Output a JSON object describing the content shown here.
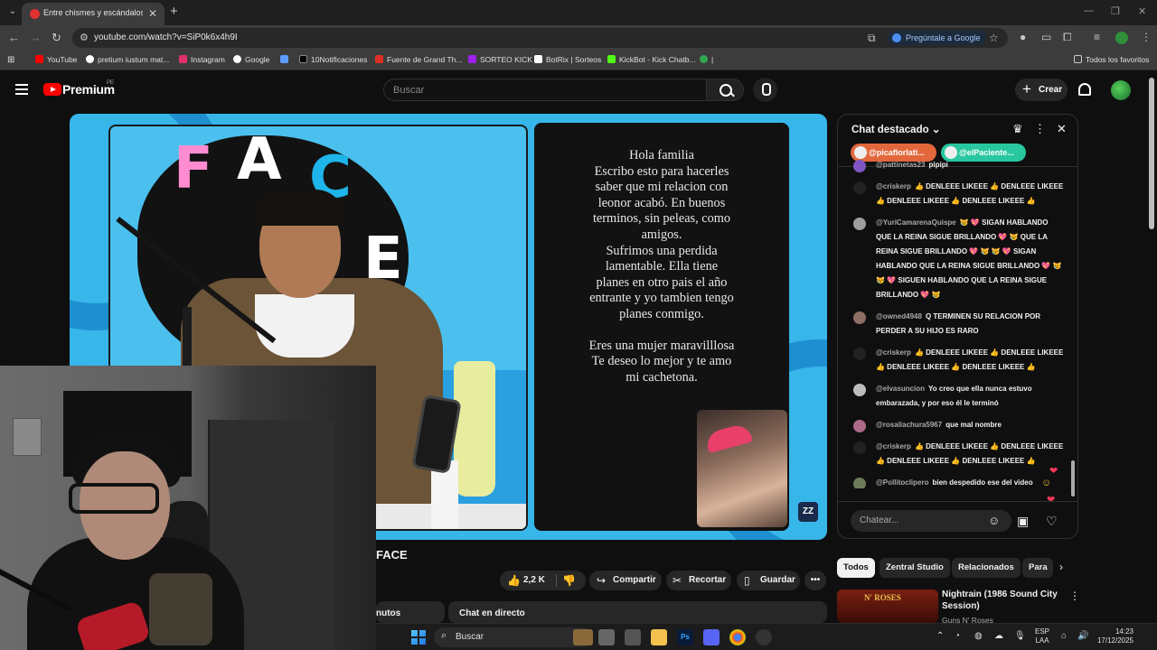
{
  "browser": {
    "tab_title": "Entre chismes y escándalos: na",
    "url": "youtube.com/watch?v=SiP0k6x4h9I",
    "ask_google": "Pregúntale a Google",
    "bookmarks": [
      {
        "label": "YouTube",
        "color": "#ff0000"
      },
      {
        "label": "pretium iustum mat...",
        "color": "#ffffff"
      },
      {
        "label": "Instagram",
        "color": "#e1306c"
      },
      {
        "label": "Google",
        "color": "#ffffff"
      },
      {
        "label": "",
        "color": "#5e9cff"
      },
      {
        "label": "10Notificaciones",
        "color": "#000000"
      },
      {
        "label": "Fuente de Grand Th...",
        "color": "#d93025"
      },
      {
        "label": "SORTEO KICK",
        "color": "#a020f0"
      },
      {
        "label": "BotRix | Sorteos",
        "color": "#ffffff"
      },
      {
        "label": "KickBot - Kick Chatb...",
        "color": "#53fc18"
      },
      {
        "label": "|",
        "color": "#34a853"
      }
    ],
    "all_bookmarks": "Todos los favoritos"
  },
  "youtube": {
    "brand": "Premium",
    "region": "PE",
    "search_placeholder": "Buscar",
    "create_label": "Crear"
  },
  "video": {
    "letter_lines": [
      "Hola familia",
      "Escribo esto para hacerles",
      "saber que mi relacion con",
      "leonor acabó. En buenos",
      "terminos, sin peleas, como",
      "amigos.",
      "Sufrimos una perdida",
      "lamentable. Ella tiene",
      "planes en otro pais el año",
      "entrante y yo tambien tengo",
      "planes conmigo.",
      "",
      "Eres una mujer maravilllosa",
      "Te deseo lo mejor y te amo",
      "mi cachetona."
    ],
    "title_fragment": "FACE",
    "likes": "2,2 K",
    "share_label": "Compartir",
    "clip_label": "Recortar",
    "save_label": "Guardar",
    "more_label": "•••",
    "tab_left_fragment": "nutos",
    "tab_chat": "Chat en directo"
  },
  "chat": {
    "title": "Chat destacado",
    "mentions": [
      "@picaflorlati...",
      "@elPaciente..."
    ],
    "messages": [
      {
        "author": "@pattinetas23",
        "text": "pipipi",
        "color": "#7e57c2"
      },
      {
        "author": "@criskerp",
        "text": "👍 DENLEEE LIKEEE 👍 DENLEEE LIKEEE 👍 DENLEEE LIKEEE 👍 DENLEEE LIKEEE 👍",
        "color": "#222222"
      },
      {
        "author": "@YuriCamarenaQuispe",
        "text": "😿 💖 SIGAN HABLANDO QUE LA REINA SIGUE BRILLANDO 💖 😿 QUE LA REINA SIGUE BRILLANDO 💖 😿 😿 💖 SIGAN HABLANDO QUE LA REINA SIGUE BRILLANDO 💖 😿 😿 💖 SIGUEN HABLANDO QUE LA REINA SIGUE BRILLANDO 💖 😿",
        "color": "#9e9e9e"
      },
      {
        "author": "@owned4948",
        "text": "Q TERMINEN SU RELACION POR PERDER A SU HIJO ES RARO",
        "color": "#8d6e63"
      },
      {
        "author": "@criskerp",
        "text": "👍 DENLEEE LIKEEE 👍 DENLEEE LIKEEE 👍 DENLEEE LIKEEE 👍 DENLEEE LIKEEE 👍",
        "color": "#222222"
      },
      {
        "author": "@elvasuncion",
        "text": "Yo creo que ella nunca estuvo embarazada, y por eso él le terminó",
        "color": "#bdbdbd"
      },
      {
        "author": "@rosaliachura5967",
        "text": "que mal nombre",
        "color": "#ad6a8a"
      },
      {
        "author": "@criskerp",
        "text": "👍 DENLEEE LIKEEE 👍 DENLEEE LIKEEE 👍 DENLEEE LIKEEE 👍 DENLEEE LIKEEE 👍",
        "color": "#222222"
      },
      {
        "author": "@Pollitoclipero",
        "text": "bien despedido ese del video",
        "color": "#6d7a5a"
      }
    ],
    "input_placeholder": "Chatear..."
  },
  "related": {
    "chips": [
      "Todos",
      "Zentral Studio",
      "Relacionados",
      "Para"
    ],
    "item_title": "Nightrain (1986 Sound City Session)",
    "item_channel": "Guns N' Roses",
    "thumb_text": "N' ROSES"
  },
  "taskbar": {
    "search_label": "Buscar",
    "lang_line1": "ESP",
    "lang_line2": "LAA",
    "time": "14:23",
    "date": "17/12/2025"
  }
}
